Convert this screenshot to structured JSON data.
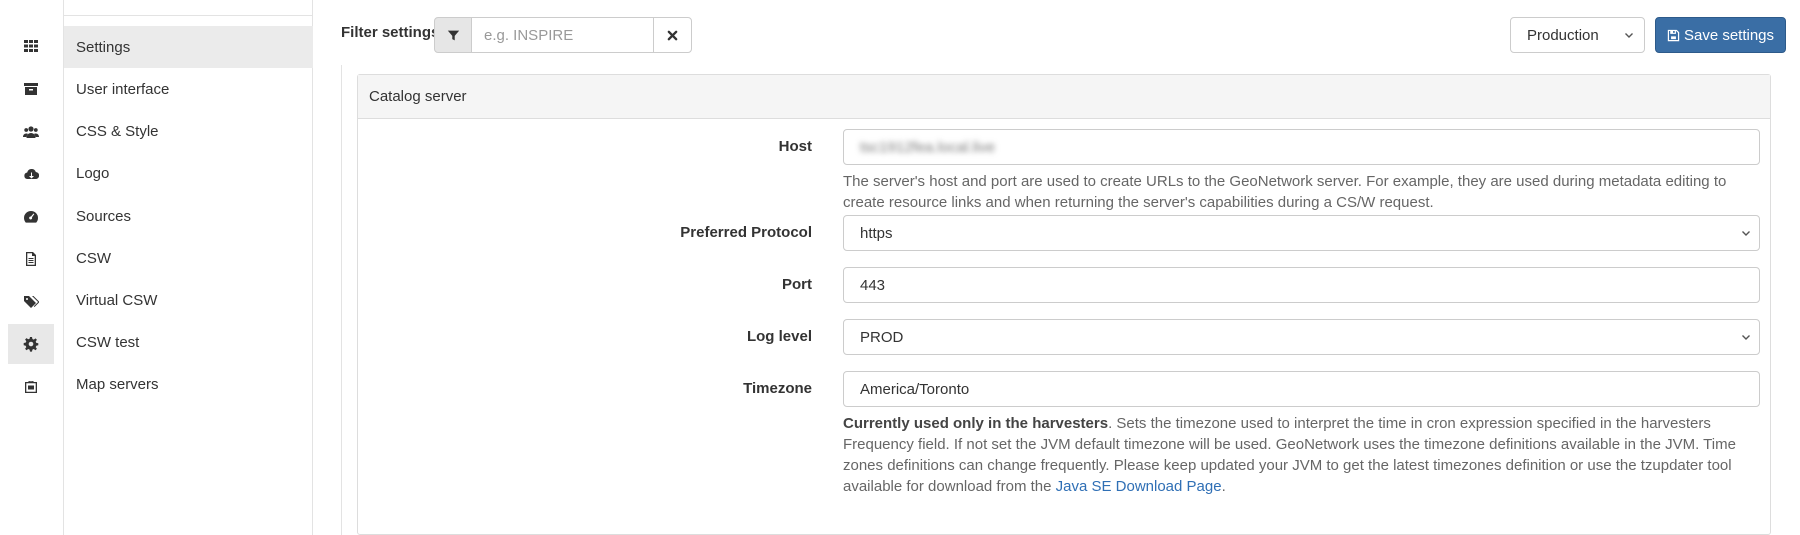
{
  "rail": {
    "items": [
      {
        "icon": "grid-icon"
      },
      {
        "icon": "archive-icon"
      },
      {
        "icon": "users-icon"
      },
      {
        "icon": "cloud-download-icon"
      },
      {
        "icon": "dashboard-icon"
      },
      {
        "icon": "file-icon"
      },
      {
        "icon": "tags-icon"
      },
      {
        "icon": "gear-icon",
        "active": true
      },
      {
        "icon": "briefcase-icon"
      }
    ]
  },
  "sidebar": {
    "items": [
      {
        "label": "Settings",
        "active": true
      },
      {
        "label": "User interface"
      },
      {
        "label": "CSS & Style"
      },
      {
        "label": "Logo"
      },
      {
        "label": "Sources"
      },
      {
        "label": "CSW"
      },
      {
        "label": "Virtual CSW"
      },
      {
        "label": "CSW test"
      },
      {
        "label": "Map servers"
      }
    ]
  },
  "toolbar": {
    "filter_label": "Filter settings",
    "filter_placeholder": "e.g. INSPIRE",
    "filter_value": "",
    "environment_selected": "Production",
    "save_label": "Save settings"
  },
  "panel": {
    "title": "Catalog server",
    "host": {
      "label": "Host",
      "value": "tsc1912fea.local.live",
      "help": "The server's host and port are used to create URLs to the GeoNetwork server. For example, they are used during metadata editing to create resource links and when returning the server's capabilities during a CS/W request."
    },
    "protocol": {
      "label": "Preferred Protocol",
      "value": "https"
    },
    "port": {
      "label": "Port",
      "value": "443"
    },
    "log_level": {
      "label": "Log level",
      "value": "PROD"
    },
    "timezone": {
      "label": "Timezone",
      "value": "America/Toronto",
      "help_bold": "Currently used only in the harvesters",
      "help_text": ". Sets the timezone used to interpret the time in cron expression specified in the harvesters Frequency field. If not set the JVM default timezone will be used. GeoNetwork uses the timezone definitions available in the JVM. Time zones definitions can change frequently. Please keep updated your JVM to get the latest timezones definition or use the tzupdater tool available for download from the ",
      "help_link": "Java SE Download Page",
      "help_end": "."
    }
  },
  "colors": {
    "accent": "#3a6ea5",
    "link": "#2f6fb5",
    "active_bg": "#ebebeb"
  }
}
